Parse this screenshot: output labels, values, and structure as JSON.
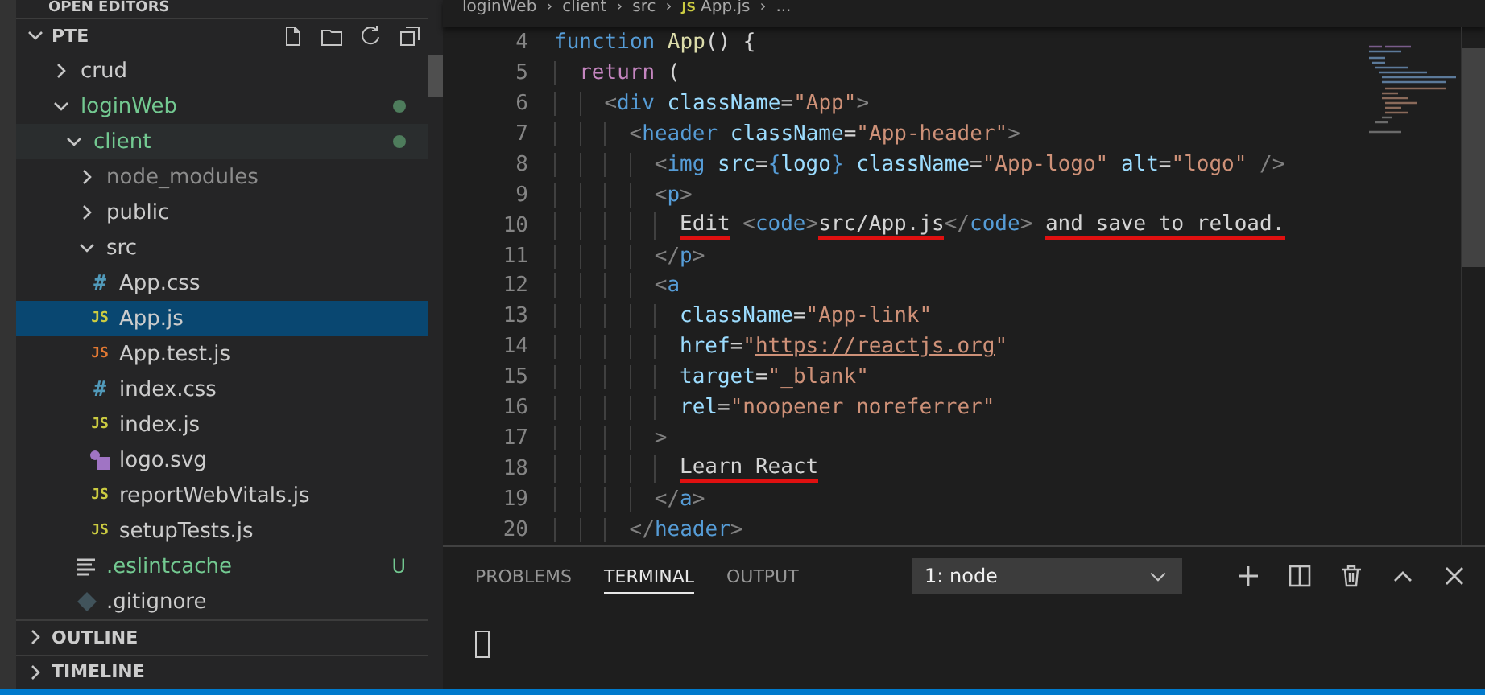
{
  "sidebar": {
    "open_editors": "OPEN EDITORS",
    "section": {
      "title": "PTE",
      "expanded": true
    },
    "tree": [
      {
        "name": "crud",
        "kind": "folder",
        "expanded": false,
        "selected": false
      },
      {
        "name": "loginWeb",
        "kind": "folder",
        "expanded": true,
        "selected": false,
        "color": "#73c991",
        "dot": true,
        "children": [
          {
            "name": "client",
            "kind": "folder",
            "expanded": true,
            "selected": false,
            "hover": true,
            "color": "#73c991",
            "dot": true,
            "children": [
              {
                "name": "node_modules",
                "kind": "folder",
                "expanded": false,
                "selected": false,
                "ignored": true
              },
              {
                "name": "public",
                "kind": "folder",
                "expanded": false,
                "selected": false
              },
              {
                "name": "src",
                "kind": "folder",
                "expanded": true,
                "selected": false,
                "children": [
                  {
                    "name": "App.css",
                    "kind": "css",
                    "glyph": "#",
                    "selected": false
                  },
                  {
                    "name": "App.js",
                    "kind": "js",
                    "glyph": "JS",
                    "selected": true
                  },
                  {
                    "name": "App.test.js",
                    "kind": "test",
                    "glyph": "JS",
                    "selected": false
                  },
                  {
                    "name": "index.css",
                    "kind": "css",
                    "glyph": "#",
                    "selected": false
                  },
                  {
                    "name": "index.js",
                    "kind": "js",
                    "glyph": "JS",
                    "selected": false
                  },
                  {
                    "name": "logo.svg",
                    "kind": "svg",
                    "selected": false
                  },
                  {
                    "name": "reportWebVitals.js",
                    "kind": "js",
                    "glyph": "JS",
                    "selected": false
                  },
                  {
                    "name": "setupTests.js",
                    "kind": "js",
                    "glyph": "JS",
                    "selected": false
                  }
                ]
              },
              {
                "name": ".eslintcache",
                "kind": "text",
                "selected": false,
                "color": "#73c991",
                "badge": "U"
              },
              {
                "name": ".gitignore",
                "kind": "git",
                "selected": false
              }
            ]
          }
        ]
      }
    ],
    "panels": [
      {
        "title": "OUTLINE",
        "expanded": false
      },
      {
        "title": "TIMELINE",
        "expanded": false
      }
    ]
  },
  "breadcrumb": [
    {
      "text": "loginWeb"
    },
    {
      "separator": "›",
      "text": "client"
    },
    {
      "separator": "›",
      "text": "src"
    },
    {
      "separator": "›",
      "text": "App.js",
      "glyph": "JS"
    },
    {
      "separator": "›",
      "text": "..."
    }
  ],
  "editor": {
    "lines": [
      {
        "number": "4",
        "tokens": [
          {
            "kind": "keyword",
            "text": "function"
          },
          {
            "kind": "func",
            "text": "App",
            "gap": true
          },
          {
            "kind": "plain",
            "text": "()"
          },
          {
            "kind": "plain",
            "text": "{",
            "gap": true
          }
        ],
        "children": [
          {
            "number": "5",
            "tokens": [
              {
                "kind": "control",
                "text": "return"
              },
              {
                "kind": "plain",
                "text": "(",
                "gap": true
              }
            ],
            "children": [
              {
                "number": "6",
                "tokens": [
                  {
                    "kind": "bracket",
                    "text": "<"
                  },
                  {
                    "kind": "tag",
                    "text": "div"
                  },
                  {
                    "kind": "attr",
                    "text": "className",
                    "gap": true
                  },
                  {
                    "kind": "plain",
                    "text": "="
                  },
                  {
                    "kind": "string",
                    "text": "\"App\""
                  },
                  {
                    "kind": "bracket",
                    "text": ">"
                  }
                ],
                "children": [
                  {
                    "number": "7",
                    "tokens": [
                      {
                        "kind": "bracket",
                        "text": "<"
                      },
                      {
                        "kind": "tag",
                        "text": "header"
                      },
                      {
                        "kind": "attr",
                        "text": "className",
                        "gap": true
                      },
                      {
                        "kind": "plain",
                        "text": "="
                      },
                      {
                        "kind": "string",
                        "text": "\"App-header\""
                      },
                      {
                        "kind": "bracket",
                        "text": ">"
                      }
                    ],
                    "children": [
                      {
                        "number": "8",
                        "tokens": [
                          {
                            "kind": "bracket",
                            "text": "<"
                          },
                          {
                            "kind": "tag",
                            "text": "img"
                          },
                          {
                            "kind": "attr",
                            "text": "src",
                            "gap": true
                          },
                          {
                            "kind": "plain",
                            "text": "="
                          },
                          {
                            "kind": "tag",
                            "text": "{"
                          },
                          {
                            "kind": "attr",
                            "text": "logo"
                          },
                          {
                            "kind": "tag",
                            "text": "}"
                          },
                          {
                            "kind": "attr",
                            "text": "className",
                            "gap": true
                          },
                          {
                            "kind": "plain",
                            "text": "="
                          },
                          {
                            "kind": "string",
                            "text": "\"App-logo\""
                          },
                          {
                            "kind": "attr",
                            "text": "alt",
                            "gap": true
                          },
                          {
                            "kind": "plain",
                            "text": "="
                          },
                          {
                            "kind": "string",
                            "text": "\"logo\""
                          },
                          {
                            "kind": "bracket",
                            "text": "/>",
                            "gap": true
                          }
                        ]
                      },
                      {
                        "number": "9",
                        "tokens": [
                          {
                            "kind": "bracket",
                            "text": "<"
                          },
                          {
                            "kind": "tag",
                            "text": "p"
                          },
                          {
                            "kind": "bracket",
                            "text": ">"
                          }
                        ],
                        "children": [
                          {
                            "number": "10",
                            "tokens": [
                              {
                                "kind": "plain",
                                "text": "Edit",
                                "marked": true
                              },
                              {
                                "kind": "bracket",
                                "text": "<",
                                "gap": true
                              },
                              {
                                "kind": "tag",
                                "text": "code"
                              },
                              {
                                "kind": "bracket",
                                "text": ">"
                              },
                              {
                                "kind": "plain",
                                "text": "src/App.js",
                                "marked": true
                              },
                              {
                                "kind": "bracket",
                                "text": "</"
                              },
                              {
                                "kind": "tag",
                                "text": "code"
                              },
                              {
                                "kind": "bracket",
                                "text": ">"
                              },
                              {
                                "kind": "plain",
                                "text": "and save to reload.",
                                "marked": true,
                                "gap": true
                              }
                            ]
                          }
                        ]
                      },
                      {
                        "number": "11",
                        "tokens": [
                          {
                            "kind": "bracket",
                            "text": "</"
                          },
                          {
                            "kind": "tag",
                            "text": "p"
                          },
                          {
                            "kind": "bracket",
                            "text": ">"
                          }
                        ]
                      },
                      {
                        "number": "12",
                        "tokens": [
                          {
                            "kind": "bracket",
                            "text": "<"
                          },
                          {
                            "kind": "tag",
                            "text": "a"
                          }
                        ],
                        "children": [
                          {
                            "number": "13",
                            "tokens": [
                              {
                                "kind": "attr",
                                "text": "className"
                              },
                              {
                                "kind": "plain",
                                "text": "="
                              },
                              {
                                "kind": "string",
                                "text": "\"App-link\""
                              }
                            ]
                          },
                          {
                            "number": "14",
                            "tokens": [
                              {
                                "kind": "attr",
                                "text": "href"
                              },
                              {
                                "kind": "plain",
                                "text": "="
                              },
                              {
                                "kind": "string",
                                "text": "\""
                              },
                              {
                                "kind": "link",
                                "text": "https://reactjs.org"
                              },
                              {
                                "kind": "string",
                                "text": "\""
                              }
                            ]
                          },
                          {
                            "number": "15",
                            "tokens": [
                              {
                                "kind": "attr",
                                "text": "target"
                              },
                              {
                                "kind": "plain",
                                "text": "="
                              },
                              {
                                "kind": "string",
                                "text": "\"_blank\""
                              }
                            ]
                          },
                          {
                            "number": "16",
                            "tokens": [
                              {
                                "kind": "attr",
                                "text": "rel"
                              },
                              {
                                "kind": "plain",
                                "text": "="
                              },
                              {
                                "kind": "string",
                                "text": "\"noopener noreferrer\""
                              }
                            ]
                          }
                        ]
                      },
                      {
                        "number": "17",
                        "tokens": [
                          {
                            "kind": "bracket",
                            "text": ">"
                          }
                        ],
                        "children": [
                          {
                            "number": "18",
                            "tokens": [
                              {
                                "kind": "plain",
                                "text": "Learn React",
                                "marked": true
                              }
                            ]
                          }
                        ]
                      },
                      {
                        "number": "19",
                        "tokens": [
                          {
                            "kind": "bracket",
                            "text": "</"
                          },
                          {
                            "kind": "tag",
                            "text": "a"
                          },
                          {
                            "kind": "bracket",
                            "text": ">"
                          }
                        ]
                      }
                    ]
                  },
                  {
                    "number": "20",
                    "tokens": [
                      {
                        "kind": "bracket",
                        "text": "</"
                      },
                      {
                        "kind": "tag",
                        "text": "header"
                      },
                      {
                        "kind": "bracket",
                        "text": ">"
                      }
                    ]
                  }
                ]
              }
            ]
          }
        ]
      }
    ]
  },
  "panel": {
    "tabs": [
      {
        "label": "PROBLEMS",
        "selected": false
      },
      {
        "label": "TERMINAL",
        "selected": true
      },
      {
        "label": "OUTPUT",
        "selected": false
      }
    ],
    "terminal_select": {
      "value": "1: node"
    }
  }
}
